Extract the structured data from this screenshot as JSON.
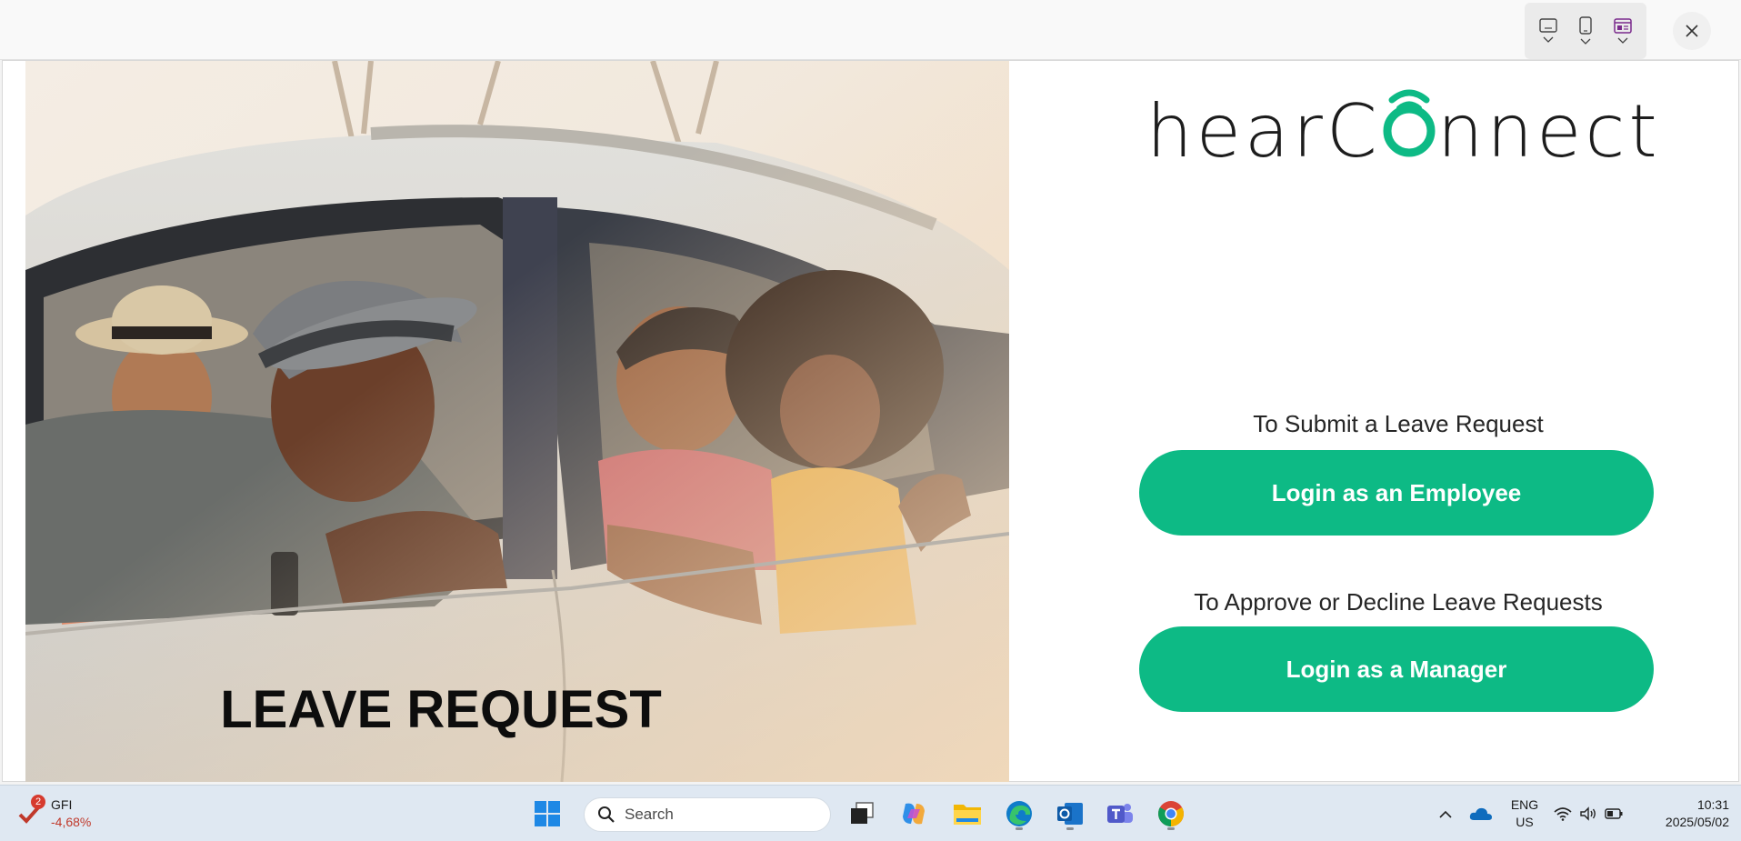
{
  "window": {
    "device_modes": [
      {
        "name": "desktop",
        "icon": "monitor-icon"
      },
      {
        "name": "mobile",
        "icon": "phone-icon"
      },
      {
        "name": "web",
        "icon": "browser-icon"
      }
    ],
    "close_icon": "close-icon"
  },
  "hero": {
    "title": "LEAVE REQUEST"
  },
  "brand": {
    "name_part1": "hear",
    "name_part2": "C",
    "name_part3": "nnect",
    "accent_color": "#0dba85"
  },
  "employee": {
    "prompt": "To Submit a Leave Request",
    "button_label": "Login as an Employee"
  },
  "manager": {
    "prompt": "To Approve or Decline Leave Requests",
    "button_label": "Login as a Manager"
  },
  "taskbar": {
    "stock": {
      "badge": "2",
      "ticker": "GFI",
      "change": "-4,68%"
    },
    "search_placeholder": "Search",
    "apps": [
      "start-icon",
      "task-view-icon",
      "copilot-icon",
      "file-explorer-icon",
      "edge-icon",
      "outlook-icon",
      "teams-icon",
      "chrome-icon"
    ],
    "language": {
      "line1": "ENG",
      "line2": "US"
    },
    "clock": {
      "time": "10:31",
      "date": "2025/05/02"
    }
  }
}
